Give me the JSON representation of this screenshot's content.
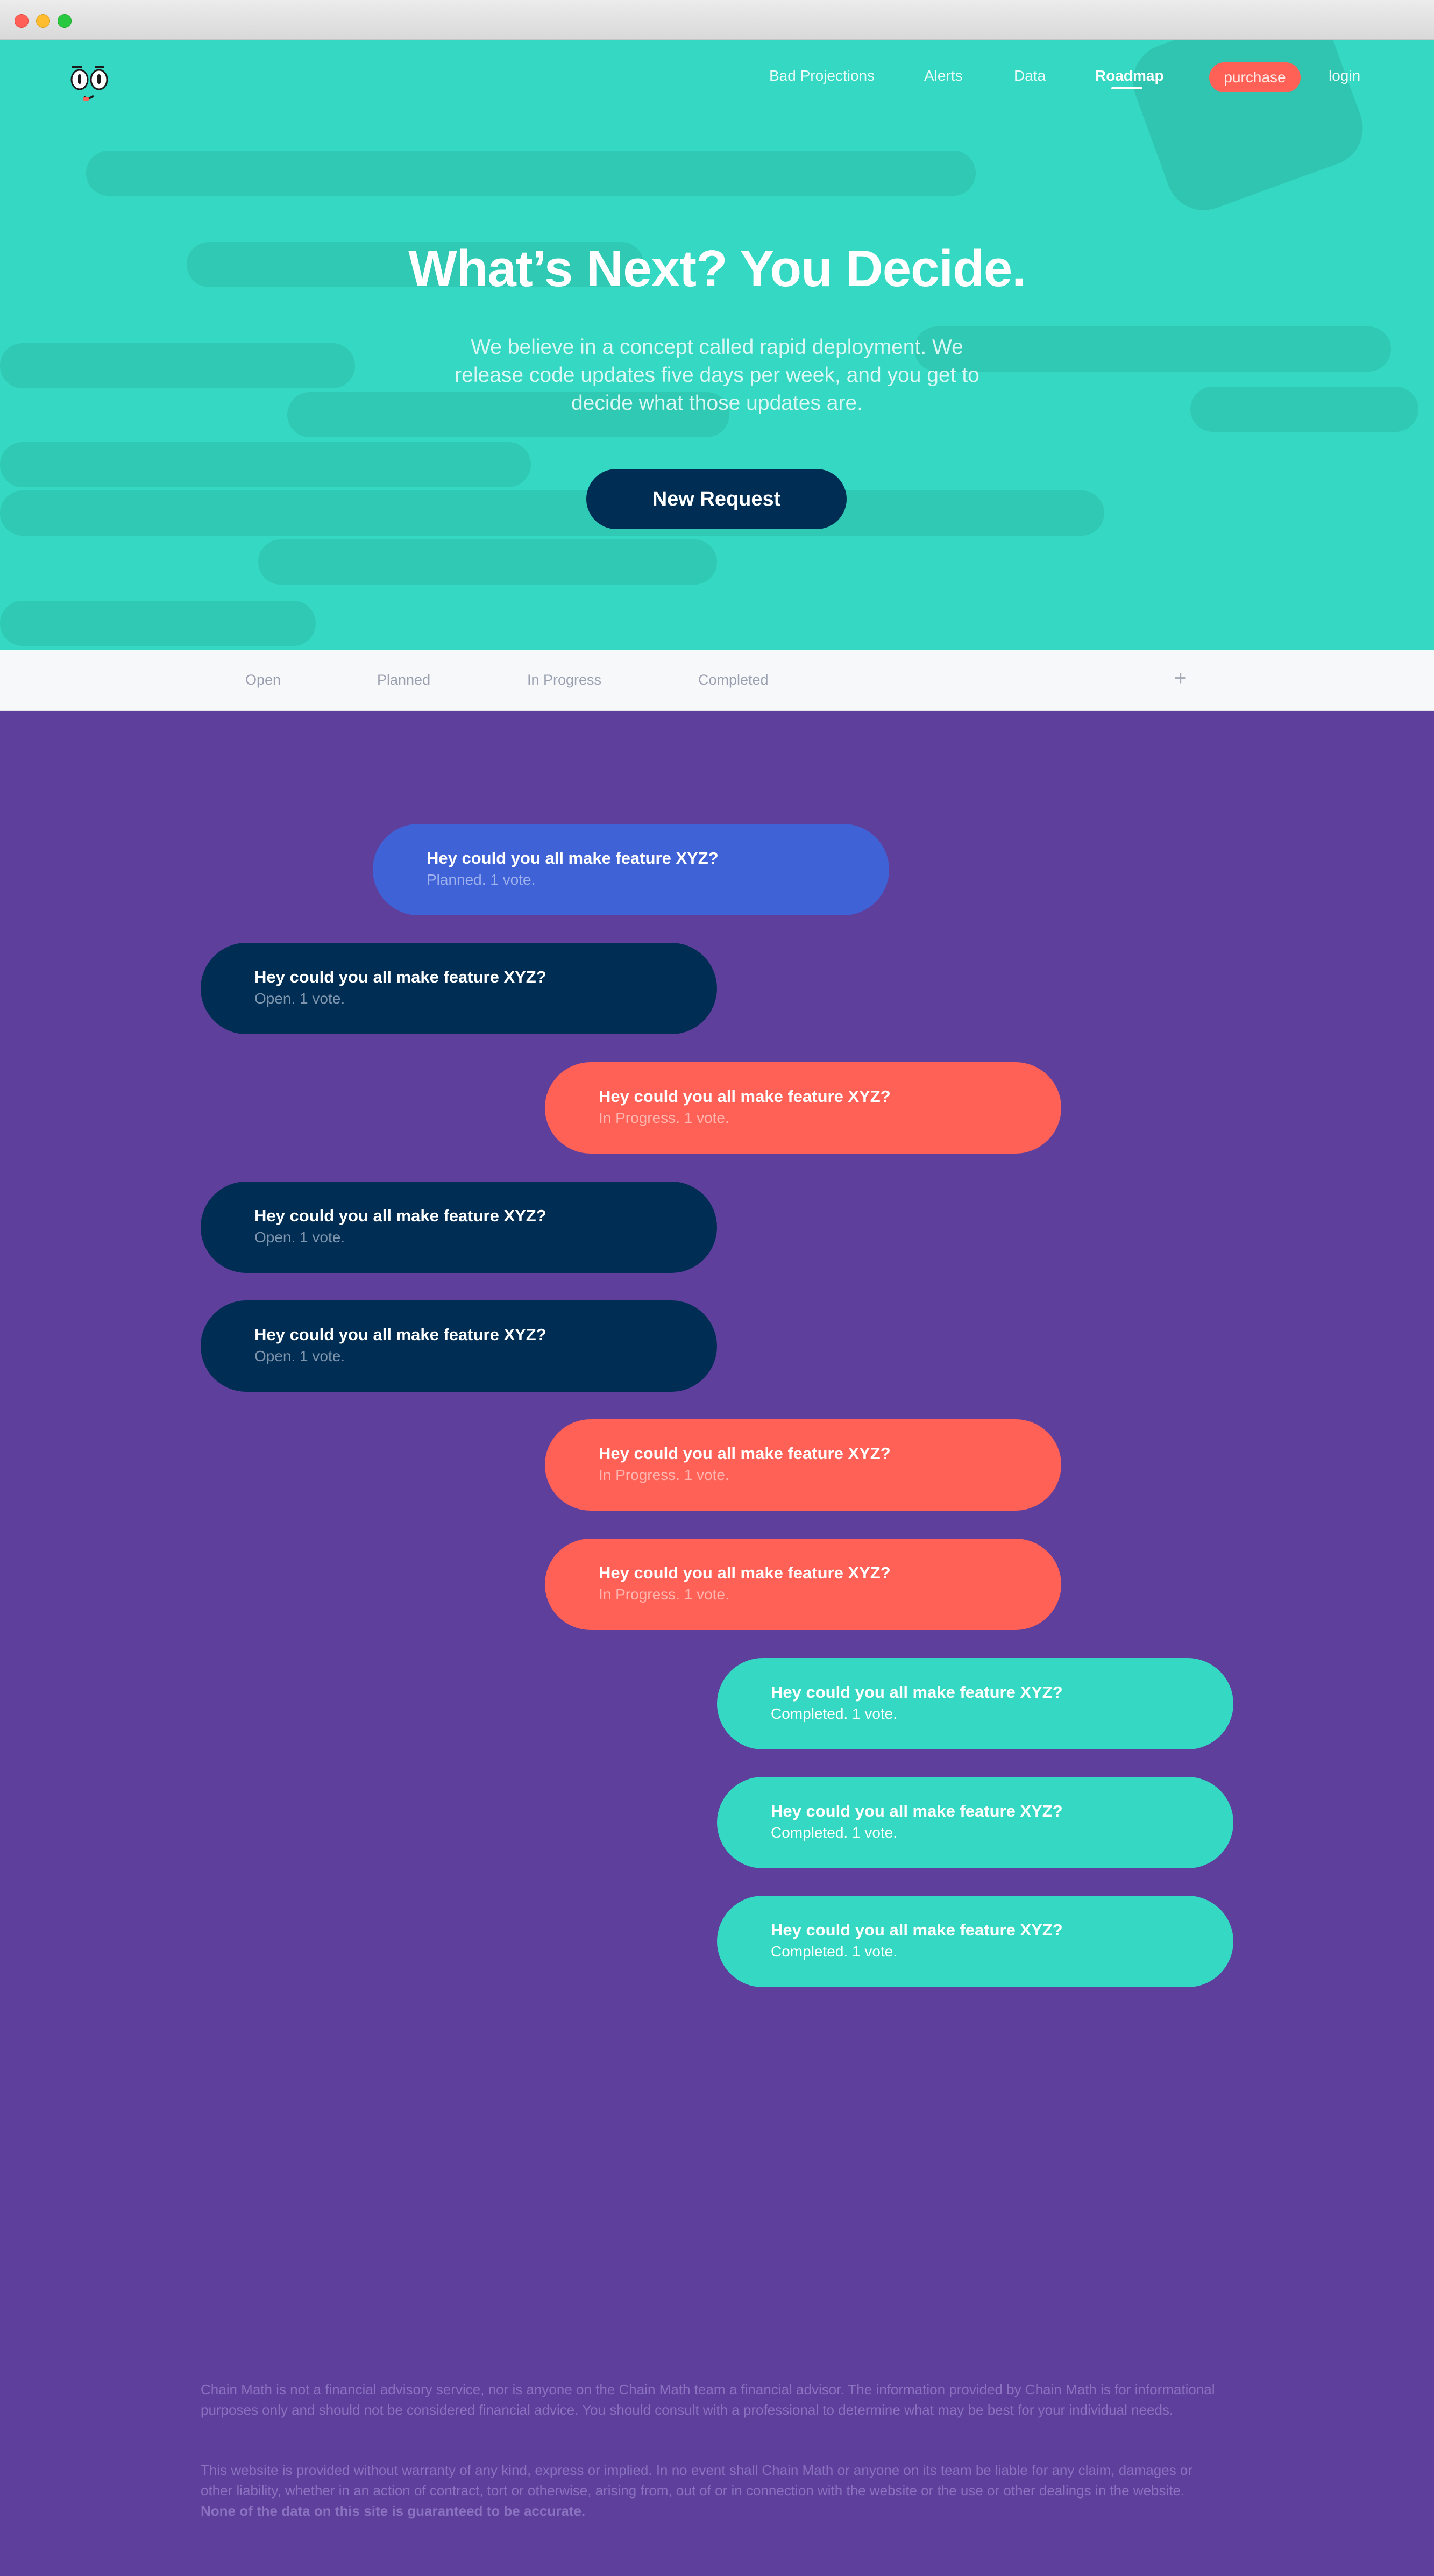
{
  "nav": {
    "links": [
      {
        "label": "Bad Projections"
      },
      {
        "label": "Alerts"
      },
      {
        "label": "Data"
      },
      {
        "label": "Roadmap"
      }
    ],
    "purchase": "purchase",
    "login": "login"
  },
  "hero": {
    "title": "What’s Next? You Decide.",
    "subtitle": "We believe in a concept called rapid deployment. We release code updates five days per week, and you get to decide what those updates are.",
    "cta": "New Request"
  },
  "tabs": {
    "items": [
      {
        "label": "Open"
      },
      {
        "label": "Planned"
      },
      {
        "label": "In Progress"
      },
      {
        "label": "Completed"
      }
    ],
    "add": "+"
  },
  "requests": [
    {
      "title": "Hey could you all make feature XYZ?",
      "meta": "Planned. 1 vote.",
      "status": "planned"
    },
    {
      "title": "Hey could you all make feature XYZ?",
      "meta": "Open. 1 vote.",
      "status": "open"
    },
    {
      "title": "Hey could you all make feature XYZ?",
      "meta": "In Progress. 1 vote.",
      "status": "progress"
    },
    {
      "title": "Hey could you all make feature XYZ?",
      "meta": "Open. 1 vote.",
      "status": "open"
    },
    {
      "title": "Hey could you all make feature XYZ?",
      "meta": "Open. 1 vote.",
      "status": "open"
    },
    {
      "title": "Hey could you all make feature XYZ?",
      "meta": "In Progress. 1 vote.",
      "status": "progress"
    },
    {
      "title": "Hey could you all make feature XYZ?",
      "meta": "In Progress. 1 vote.",
      "status": "progress"
    },
    {
      "title": "Hey could you all make feature XYZ?",
      "meta": "Completed. 1 vote.",
      "status": "completed"
    },
    {
      "title": "Hey could you all make feature XYZ?",
      "meta": "Completed. 1 vote.",
      "status": "completed"
    },
    {
      "title": "Hey could you all make feature XYZ?",
      "meta": "Completed. 1 vote.",
      "status": "completed"
    }
  ],
  "footer": {
    "disclaimer_1": "Chain Math is not a financial advisory service, nor is anyone on the Chain Math team a financial advisor. The information provided by Chain Math is for informational purposes only and should not be considered financial advice. You should consult with a professional to determine what may be best for your individual needs.",
    "disclaimer_2": "This website is provided without warranty of any kind, express or implied. In no event shall Chain Math or anyone on its team be liable for any claim, damages or other liability, whether in an action of contract, tort or otherwise, arising from, out of or in connection with the website or the use or other dealings in the website.",
    "disclaimer_2_bold": "None of the data on this site is guaranteed to be accurate."
  },
  "colors": {
    "hero": "#35d9c3",
    "body": "#5e3f9b",
    "navy": "#002d53",
    "coral": "#ff6156",
    "blue": "#3f62d6",
    "teal": "#35d9c3"
  }
}
